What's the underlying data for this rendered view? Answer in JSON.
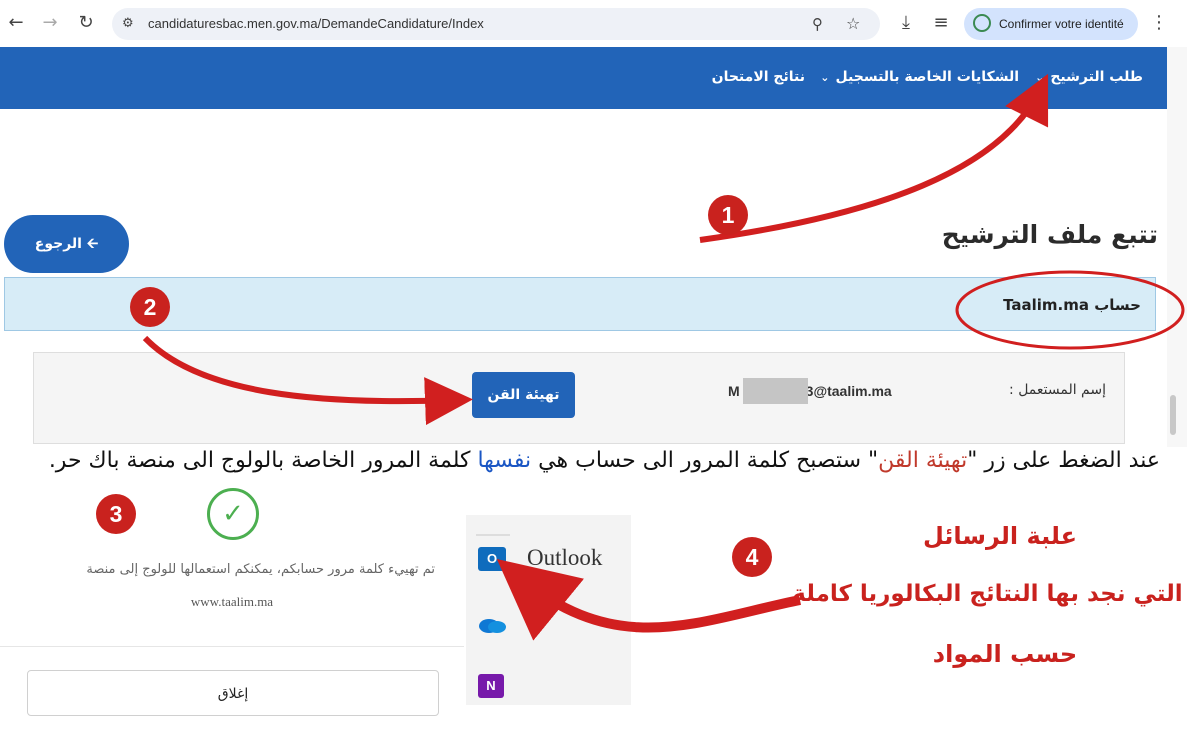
{
  "browser": {
    "url": "candidaturesbac.men.gov.ma/DemandeCandidature/Index",
    "identity_button": "Confirmer votre identité"
  },
  "nav": {
    "items": [
      "طلب الترشيح",
      "الشكايات الخاصة بالتسجيل",
      "نتائج الامتحان"
    ]
  },
  "page": {
    "title": "تتبع ملف الترشيح",
    "back_button": "الرجوع",
    "account_label": "حساب Taalim.ma",
    "username_label": "إسم المستعمل :",
    "username_value_prefix": "M",
    "username_value_suffix": "3@taalim.ma",
    "reset_button": "تهيئة القن"
  },
  "instruction": {
    "part1": "عند الضغط على زر \"",
    "highlight1": "تهيئة القن",
    "part2": "\" ستصبح كلمة المرور الى حساب هي ",
    "highlight2": "نفسها",
    "part3": " كلمة المرور الخاصة بالولوج الى منصة باك حر."
  },
  "modal": {
    "message": "تم تهييء كلمة مرور حسابكم، يمكنكم استعمالها للولوج إلى منصة",
    "site": "www.taalim.ma",
    "close_button": "إغلاق"
  },
  "outlook": {
    "app_label": "Outlook",
    "outlook_icon_text": "O",
    "onenote_icon_text": "N",
    "annotation_line1": "علبة الرسائل",
    "annotation_line2": "التي نجد بها النتائج البكالوريا كاملة",
    "annotation_line3": "حسب المواد"
  },
  "steps": [
    "1",
    "2",
    "3",
    "4"
  ],
  "colors": {
    "nav_blue": "#2264b8",
    "annotation_red": "#c9221e",
    "check_green": "#4caf50"
  }
}
